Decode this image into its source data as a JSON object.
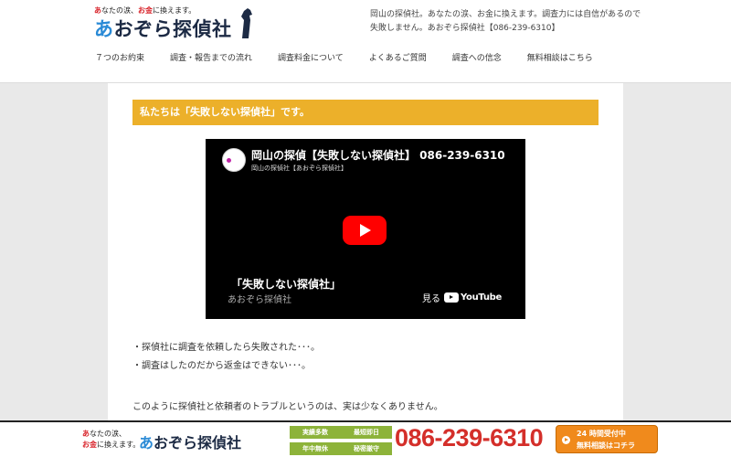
{
  "header": {
    "tagline_pre": "あ",
    "tagline_mid1": "なたの涙、",
    "tagline_red": "お金",
    "tagline_post": "に換えます。",
    "logo_first": "あ",
    "logo_rest": "おぞら探偵社",
    "description": "岡山の探偵社。あなたの涙、お金に換えます。調査力には自信があるので失敗しません。あおぞら探偵社【086-239-6310】"
  },
  "nav": {
    "items": [
      {
        "label": "７つのお約束"
      },
      {
        "label": "調査・報告までの流れ"
      },
      {
        "label": "調査料金について"
      },
      {
        "label": "よくあるご質問"
      },
      {
        "label": "調査への信念"
      },
      {
        "label": "無料相談はこちら"
      }
    ]
  },
  "main": {
    "heading": "私たちは「失敗しない探偵社」です。",
    "video": {
      "title": "岡山の探偵【失敗しない探偵社】 086-239-6310",
      "channel": "岡山の探偵社【あおぞら探偵社】",
      "caption": "「失敗しない探偵社」",
      "brand": "あおぞら探偵社",
      "watch_label": "見る",
      "youtube_label": "YouTube"
    },
    "paragraphs": [
      "・探偵社に調査を依頼したら失敗された･･･。",
      "・調査はしたのだから返金はできない･･･。",
      "このように探偵社と依頼者のトラブルというのは、実は少なくありません。"
    ]
  },
  "footer_bar": {
    "tag_line1_red": "あ",
    "tag_line1_rest": "なたの涙、",
    "tag_line2_red": "お金",
    "tag_line2_rest": "に換えます。",
    "logo_first": "あ",
    "logo_rest": "おぞら探偵社",
    "badges": [
      "実績多数",
      "最短即日",
      "年中無休",
      "秘密厳守"
    ],
    "phone": "086-239-6310",
    "cta_line1": "24 時間受付中",
    "cta_line2": "無料相談はコチラ"
  },
  "colors": {
    "heading_bg": "#ecb02a",
    "phone": "#d42f2a",
    "badge": "#8db33a",
    "cta": "#f08a1c",
    "youtube_red": "#ff0000"
  }
}
